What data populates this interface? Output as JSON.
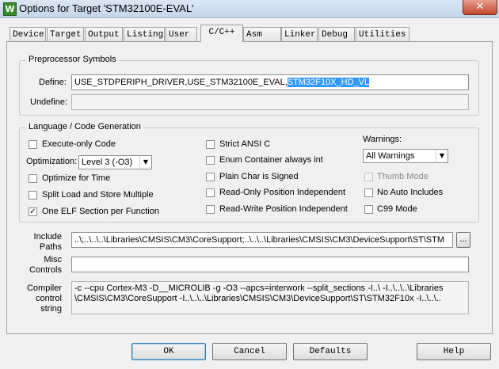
{
  "window": {
    "icon": "W",
    "title": "Options for Target 'STM32100E-EVAL'",
    "close": "✕"
  },
  "tabs": [
    {
      "label": "Device"
    },
    {
      "label": "Target"
    },
    {
      "label": "Output"
    },
    {
      "label": "Listing"
    },
    {
      "label": "User"
    },
    {
      "label": "C/C++",
      "active": true
    },
    {
      "label": "Asm"
    },
    {
      "label": "Linker"
    },
    {
      "label": "Debug"
    },
    {
      "label": "Utilities"
    }
  ],
  "preprocessor": {
    "group_label": "Preprocessor Symbols",
    "define_label": "Define:",
    "define_value": "USE_STDPERIPH_DRIVER,USE_STM32100E_EVAL,",
    "define_selected": "STM32F10X_HD_VL",
    "undefine_label": "Undefine:",
    "undefine_value": ""
  },
  "language": {
    "group_label": "Language / Code Generation",
    "execute_only": {
      "label": "Execute-only Code",
      "checked": false
    },
    "optimization_label": "Optimization:",
    "optimization_value": "Level 3 (-O3)",
    "optimize_time": {
      "label": "Optimize for Time",
      "checked": false
    },
    "split_load": {
      "label": "Split Load and Store Multiple",
      "checked": false
    },
    "one_elf": {
      "label": "One ELF Section per Function",
      "checked": true
    },
    "strict_ansi": {
      "label": "Strict ANSI C",
      "checked": false
    },
    "enum_container": {
      "label": "Enum Container always int",
      "checked": false
    },
    "plain_char": {
      "label": "Plain Char is Signed",
      "checked": false
    },
    "ro_position": {
      "label": "Read-Only Position Independent",
      "checked": false
    },
    "rw_position": {
      "label": "Read-Write Position Independent",
      "checked": false
    },
    "warnings_label": "Warnings:",
    "warnings_value": "All Warnings",
    "thumb_mode": {
      "label": "Thumb Mode",
      "checked": false,
      "disabled": true
    },
    "no_auto_includes": {
      "label": "No Auto Includes",
      "checked": false
    },
    "c99_mode": {
      "label": "C99 Mode",
      "checked": false
    }
  },
  "paths": {
    "include_label": "Include\nPaths",
    "include_value": "..\\;..\\..\\..\\Libraries\\CMSIS\\CM3\\CoreSupport;..\\..\\..\\Libraries\\CMSIS\\CM3\\DeviceSupport\\ST\\STM",
    "browse": "...",
    "misc_label": "Misc\nControls",
    "misc_value": "",
    "compiler_label": "Compiler\ncontrol\nstring",
    "compiler_value": "-c --cpu Cortex-M3 -D__MICROLIB -g -O3 --apcs=interwork --split_sections -I..\\ -I..\\..\\..\\Libraries\n\\CMSIS\\CM3\\CoreSupport -I..\\..\\..\\Libraries\\CMSIS\\CM3\\DeviceSupport\\ST\\STM32F10x -I..\\..\\.."
  },
  "buttons": {
    "ok": "OK",
    "cancel": "Cancel",
    "defaults": "Defaults",
    "help": "Help"
  }
}
